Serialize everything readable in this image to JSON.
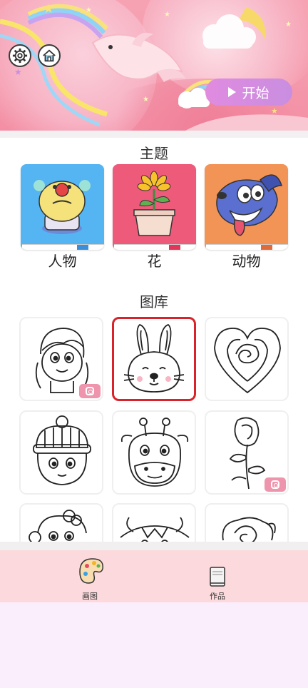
{
  "header": {
    "settings_icon": "gear-icon",
    "home_icon": "home-icon",
    "start_label": "开始"
  },
  "themes": {
    "title": "主题",
    "items": [
      {
        "label": "人物",
        "color": "#55b4f2",
        "icon": "clown-icon"
      },
      {
        "label": "花",
        "color": "#ee5a7a",
        "icon": "flower-pot-icon"
      },
      {
        "label": "动物",
        "color": "#f39457",
        "icon": "dog-icon"
      }
    ]
  },
  "gallery": {
    "title": "图库",
    "items": [
      {
        "name": "girl-drawing",
        "selected": false,
        "ig_badge": true
      },
      {
        "name": "bunny-drawing",
        "selected": true,
        "ig_badge": false
      },
      {
        "name": "heart-rose-drawing",
        "selected": false,
        "ig_badge": false
      },
      {
        "name": "winter-hat-girl-drawing",
        "selected": false,
        "ig_badge": false
      },
      {
        "name": "giraffe-drawing",
        "selected": false,
        "ig_badge": false
      },
      {
        "name": "rose-drawing",
        "selected": false,
        "ig_badge": true
      },
      {
        "name": "monkey-drawing",
        "selected": false,
        "ig_badge": false
      },
      {
        "name": "cow-drawing",
        "selected": false,
        "ig_badge": false
      },
      {
        "name": "rose-bloom-drawing",
        "selected": false,
        "ig_badge": false
      }
    ]
  },
  "tabbar": {
    "tabs": [
      {
        "label": "画图",
        "icon": "palette-icon"
      },
      {
        "label": "作品",
        "icon": "book-icon"
      }
    ]
  },
  "colors": {
    "selected_border": "#d8232a",
    "start_button": "#d98ce0",
    "tabbar_bg": "#fcd9dc"
  }
}
